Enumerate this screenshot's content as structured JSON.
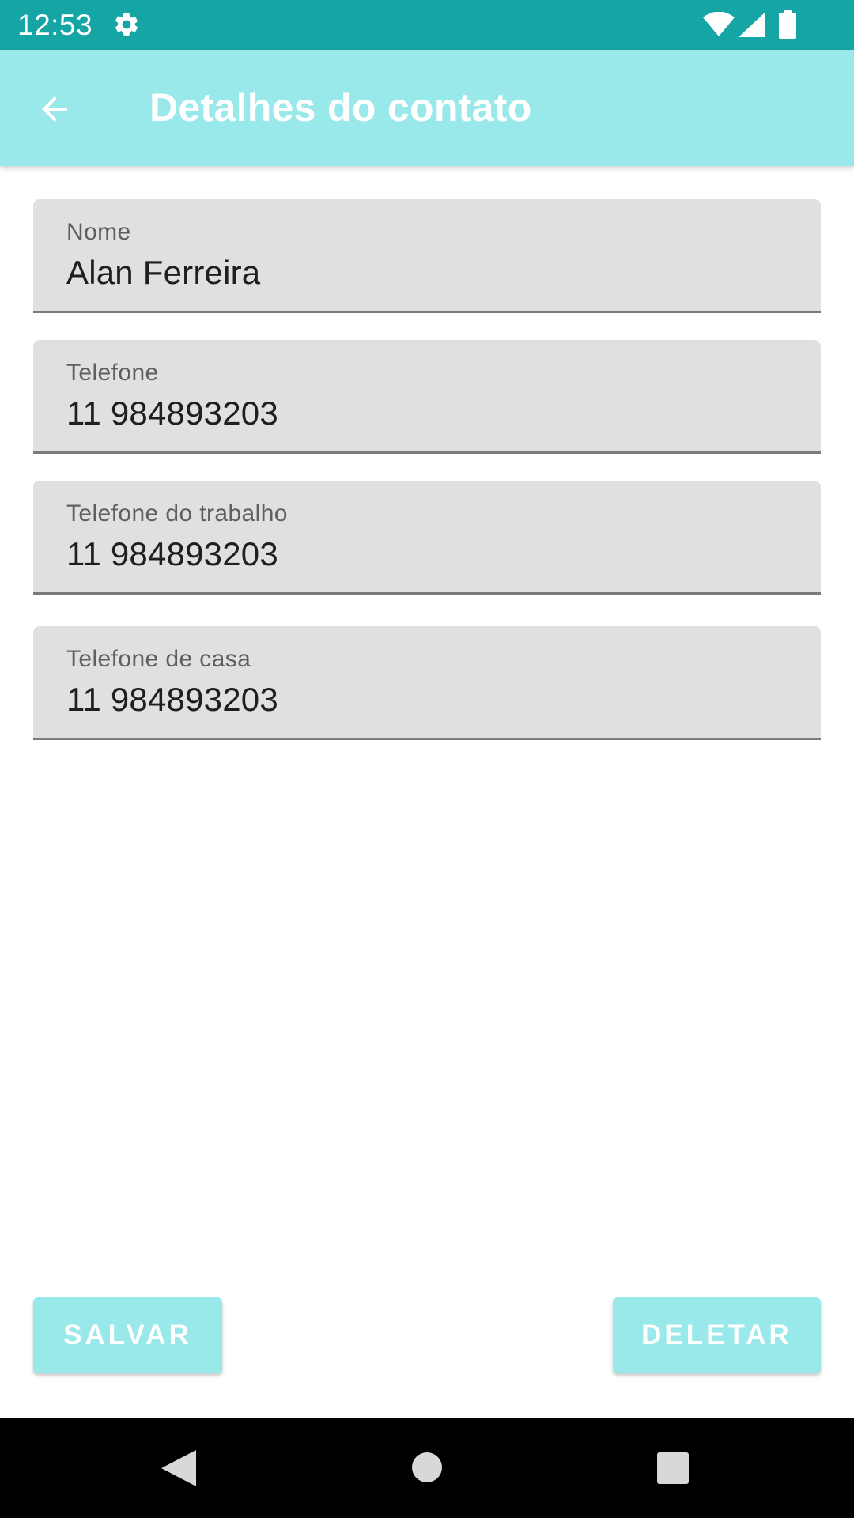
{
  "status_bar": {
    "time": "12:53",
    "icons": [
      "gear-icon",
      "wifi-icon",
      "signal-icon",
      "battery-icon"
    ],
    "color": "#16a5a5"
  },
  "app_bar": {
    "title": "Detalhes do contato",
    "back_icon": "arrow-left-icon",
    "color": "#99e9ea"
  },
  "form": {
    "nome": {
      "label": "Nome",
      "value": "Alan Ferreira"
    },
    "telefone": {
      "label": "Telefone",
      "value": "11 984893203"
    },
    "telefone_trabalho": {
      "label": "Telefone do trabalho",
      "value": "11 984893203"
    },
    "telefone_casa": {
      "label": "Telefone de casa",
      "value": "11 984893203"
    }
  },
  "actions": {
    "save_label": "SALVAR",
    "delete_label": "DELETAR",
    "button_color": "#99e9ea"
  },
  "nav_bar": {
    "icons": [
      "back-triangle-icon",
      "home-circle-icon",
      "recents-square-icon"
    ]
  }
}
